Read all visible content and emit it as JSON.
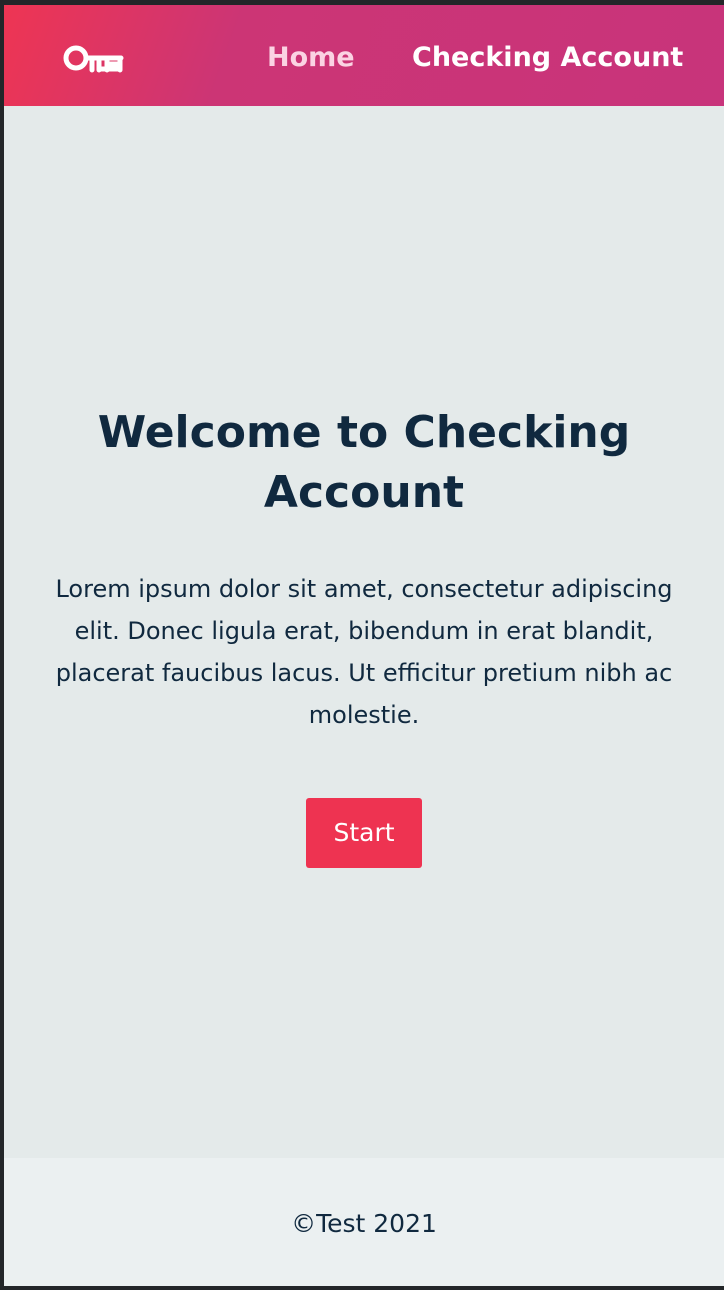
{
  "nav": {
    "home_label": "Home",
    "checking_label": "Checking Account",
    "logo_icon": "key-logo-icon"
  },
  "hero": {
    "title": "Welcome to Checking Account",
    "text": "Lorem ipsum dolor sit amet, consectetur adipiscing elit. Donec ligula erat, bibendum in erat blandit, placerat faucibus lacus. Ut efficitur pretium nibh ac molestie.",
    "start_label": "Start"
  },
  "footer": {
    "text": "©Test 2021"
  },
  "colors": {
    "gradient_start": "#ee3553",
    "gradient_end": "#c8347b",
    "home_link": "#fbd3e3",
    "text_dark": "#10293f",
    "button": "#ee3351",
    "page_bg": "#e4eaea",
    "footer_bg": "#ebf0f1"
  }
}
